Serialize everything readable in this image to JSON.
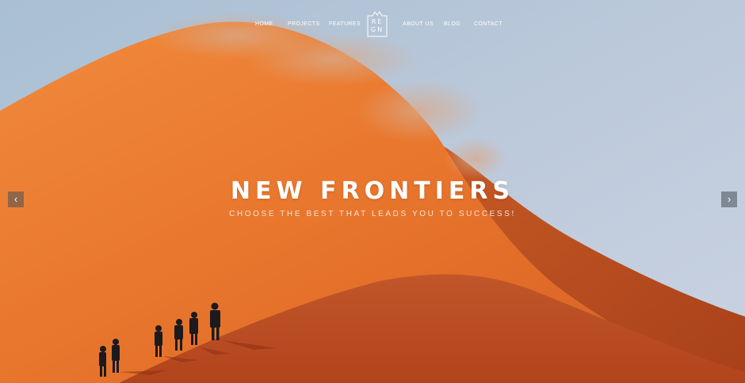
{
  "nav": {
    "items": [
      {
        "label": "HOME"
      },
      {
        "label": "PROJECTS"
      },
      {
        "label": "FEATURES"
      },
      {
        "label": "ABOUT US"
      },
      {
        "label": "BLOG"
      },
      {
        "label": "CONTACT"
      }
    ],
    "logo": {
      "line1": "RE",
      "line2": "GN"
    }
  },
  "hero": {
    "title": "NEW FRONTIERS",
    "subtitle": "CHOOSE THE BEST THAT LEADS YOU TO SUCCESS!",
    "prev_icon": "chevron-left-icon",
    "next_icon": "chevron-right-icon"
  },
  "colors": {
    "sky": "#b9c9dc",
    "dune": "#e36c24",
    "dune_shadow": "#b9481d"
  }
}
